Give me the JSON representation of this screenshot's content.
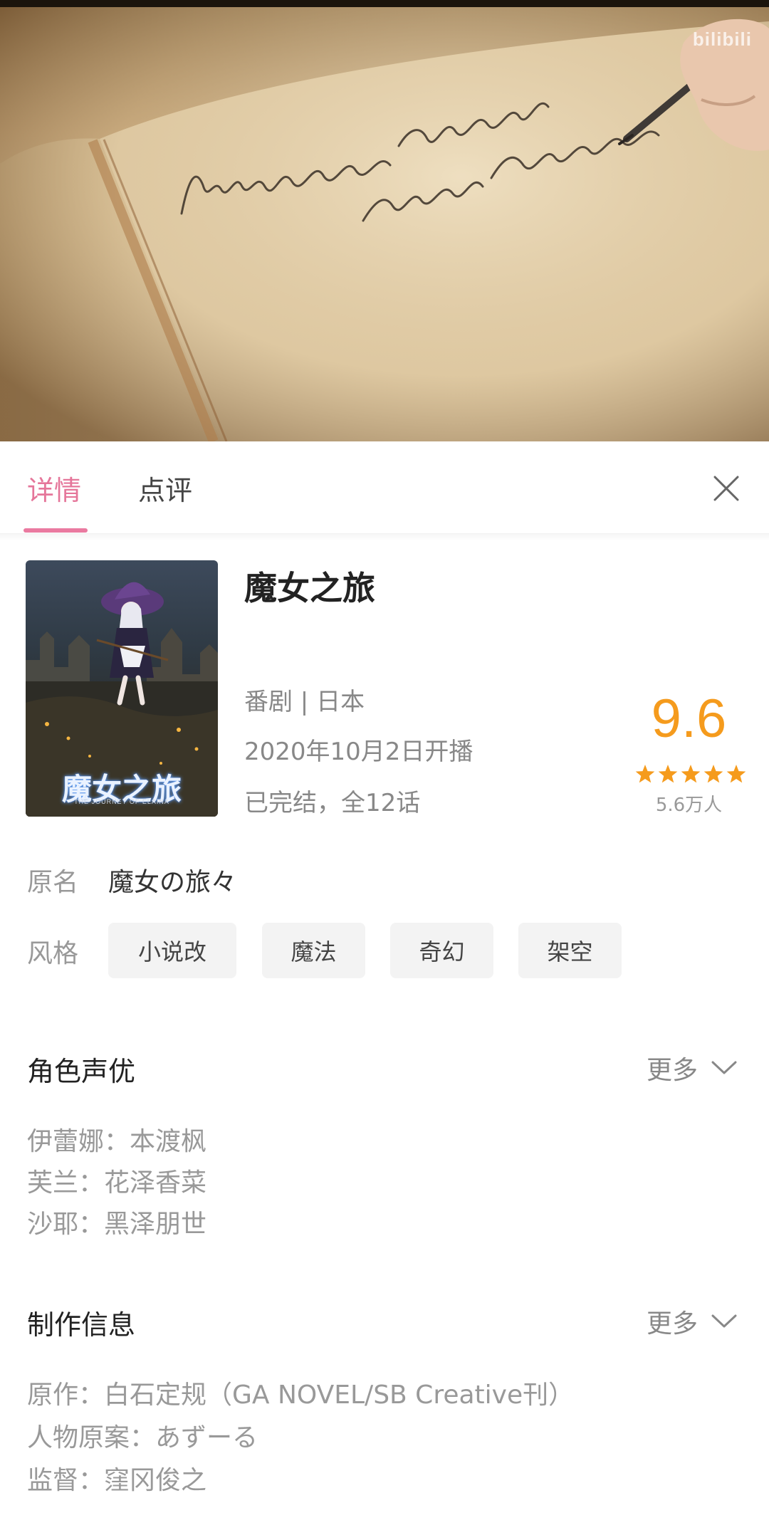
{
  "video": {
    "watermark": "bilibili"
  },
  "tabs": [
    {
      "label": "详情",
      "active": true
    },
    {
      "label": "点评",
      "active": false
    }
  ],
  "info": {
    "title": "魔女之旅",
    "type_line": "番剧 | 日本",
    "date_line": "2020年10月2日开播",
    "status_line": "已完结，全12话",
    "score": "9.6",
    "stars": 5,
    "rating_count": "5.6万人",
    "poster_title": "魔女之旅",
    "poster_subtitle": "THE JOURNEY OF ELAINA"
  },
  "original_name": {
    "label": "原名",
    "value": "魔女の旅々"
  },
  "style": {
    "label": "风格",
    "tags": [
      "小说改",
      "魔法",
      "奇幻",
      "架空"
    ]
  },
  "cast": {
    "title": "角色声优",
    "more_label": "更多",
    "items": [
      {
        "role": "伊蕾娜",
        "actor": "本渡枫"
      },
      {
        "role": "芙兰",
        "actor": "花泽香菜"
      },
      {
        "role": "沙耶",
        "actor": "黑泽朋世"
      }
    ]
  },
  "production": {
    "title": "制作信息",
    "more_label": "更多",
    "items": [
      {
        "key": "原作",
        "value": "白石定规（GA NOVEL/SB Creative刊）"
      },
      {
        "key": "人物原案",
        "value": "あずーる"
      },
      {
        "key": "监督",
        "value": "窪冈俊之"
      }
    ]
  },
  "colors": {
    "accent_pink": "#ea7aa0",
    "score_orange": "#f59b1d"
  }
}
